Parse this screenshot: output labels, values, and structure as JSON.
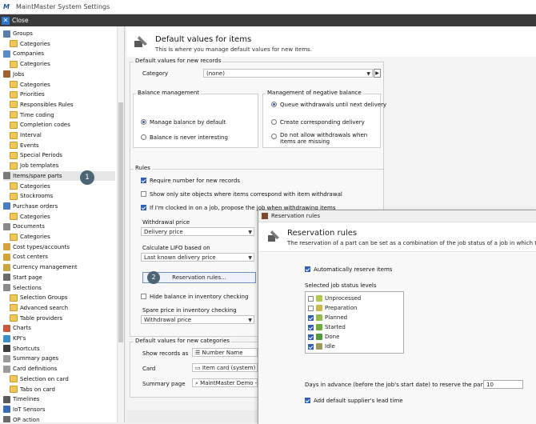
{
  "window": {
    "title": "MaintMaster System Settings"
  },
  "menubar": {
    "close_label": "Close"
  },
  "sidebar": {
    "items": [
      {
        "label": "Groups",
        "level": 0,
        "color": "#5a7fa8"
      },
      {
        "label": "Categories",
        "level": 1
      },
      {
        "label": "Companies",
        "level": 0,
        "color": "#5b8cc9"
      },
      {
        "label": "Categories",
        "level": 1
      },
      {
        "label": "Jobs",
        "level": 0,
        "color": "#a06030"
      },
      {
        "label": "Categories",
        "level": 1
      },
      {
        "label": "Priorities",
        "level": 1
      },
      {
        "label": "Responsibles Rules",
        "level": 1
      },
      {
        "label": "Time coding",
        "level": 1
      },
      {
        "label": "Completion codes",
        "level": 1
      },
      {
        "label": "Interval",
        "level": 1
      },
      {
        "label": "Events",
        "level": 1
      },
      {
        "label": "Special Periods",
        "level": 1
      },
      {
        "label": "Job templates",
        "level": 1
      },
      {
        "label": "Items/spare parts",
        "level": 0,
        "color": "#7a7a7a",
        "selected": true
      },
      {
        "label": "Categories",
        "level": 1
      },
      {
        "label": "Stockrooms",
        "level": 1
      },
      {
        "label": "Purchase orders",
        "level": 0,
        "color": "#4c7cc0"
      },
      {
        "label": "Categories",
        "level": 1
      },
      {
        "label": "Documents",
        "level": 0,
        "color": "#8a8a8a"
      },
      {
        "label": "Categories",
        "level": 1
      },
      {
        "label": "Cost types/accounts",
        "level": 0,
        "color": "#d6a23a"
      },
      {
        "label": "Cost centers",
        "level": 0,
        "color": "#d6a23a"
      },
      {
        "label": "Currency management",
        "level": 0,
        "color": "#c9a642"
      },
      {
        "label": "Start page",
        "level": 0,
        "color": "#6b6b6b"
      },
      {
        "label": "Selections",
        "level": 0,
        "color": "#8c8c8c"
      },
      {
        "label": "Selection Groups",
        "level": 1
      },
      {
        "label": "Advanced search",
        "level": 1
      },
      {
        "label": "Table providers",
        "level": 1
      },
      {
        "label": "Charts",
        "level": 0,
        "color": "#c65a3a"
      },
      {
        "label": "KPI's",
        "level": 0,
        "color": "#3d8fc9"
      },
      {
        "label": "Shortcuts",
        "level": 0,
        "color": "#3d3d3d"
      },
      {
        "label": "Summary pages",
        "level": 0,
        "color": "#9a9a9a"
      },
      {
        "label": "Card definitions",
        "level": 0,
        "color": "#9a9a9a"
      },
      {
        "label": "Selection on card",
        "level": 1
      },
      {
        "label": "Tabs on card",
        "level": 1
      },
      {
        "label": "Timelines",
        "level": 0,
        "color": "#5a5a5a"
      },
      {
        "label": "IoT Sensors",
        "level": 0,
        "color": "#3a6ab3"
      },
      {
        "label": "OP action",
        "level": 0,
        "color": "#6b6b6b"
      }
    ]
  },
  "badges": {
    "one": "1",
    "two": "2"
  },
  "header": {
    "title": "Default values for items",
    "subtitle": "This is where you manage default values for new items."
  },
  "new_records": {
    "title": "Default values for new records",
    "category_label": "Category",
    "category_value": "(none)"
  },
  "balance": {
    "title": "Balance management",
    "opt1": "Manage balance by default",
    "opt2": "Balance is never interesting"
  },
  "negative": {
    "title": "Management of negative balance",
    "opt1": "Queue withdrawals until next delivery",
    "opt2": "Create corresponding delivery",
    "opt3": "Do not allow withdrawals when items are missing"
  },
  "rules": {
    "title": "Rules",
    "chk1": "Require number for new records",
    "chk2": "Show only site objects where items correspond with item withdrawal",
    "chk3": "If I'm clocked in on a job, propose the job when withdrawing items",
    "withdrawal_price_label": "Withdrawal price",
    "withdrawal_price_value": "Delivery price",
    "lifo_label": "Calculate LIFO based on",
    "lifo_value": "Last known delivery price",
    "reservation_button": "Reservation rules...",
    "chk4": "Hide balance in inventory checking",
    "spare_price_label": "Spare price in inventory checking",
    "spare_price_value": "Withdrawal price"
  },
  "new_categories": {
    "title": "Default values for new categories",
    "show_label": "Show records as",
    "show_value": "Number Name",
    "card_label": "Card",
    "card_value": "Item card (system)",
    "summary_label": "Summary page",
    "summary_value": "MaintMaster Demo - I"
  },
  "dialog": {
    "window_title": "Reservation rules",
    "title": "Reservation rules",
    "subtitle": "The reservation of a part can be set as a combination of the job status of a job in which the par...",
    "auto_reserve": "Automatically reserve items",
    "levels_label": "Selected job status levels",
    "statuses": [
      {
        "label": "Unprocessed",
        "checked": false,
        "color": "#b5c74a"
      },
      {
        "label": "Preparation",
        "checked": false,
        "color": "#c9b84a"
      },
      {
        "label": "Planned",
        "checked": true,
        "color": "#8fbf4a"
      },
      {
        "label": "Started",
        "checked": true,
        "color": "#6fae3a"
      },
      {
        "label": "Done",
        "checked": true,
        "color": "#4f9c3a"
      },
      {
        "label": "Idle",
        "checked": true,
        "color": "#9a9a5a"
      }
    ],
    "days_label": "Days in advance (before the job's start date) to reserve the part:",
    "days_value": "10",
    "lead_time": "Add default supplier's lead time"
  }
}
